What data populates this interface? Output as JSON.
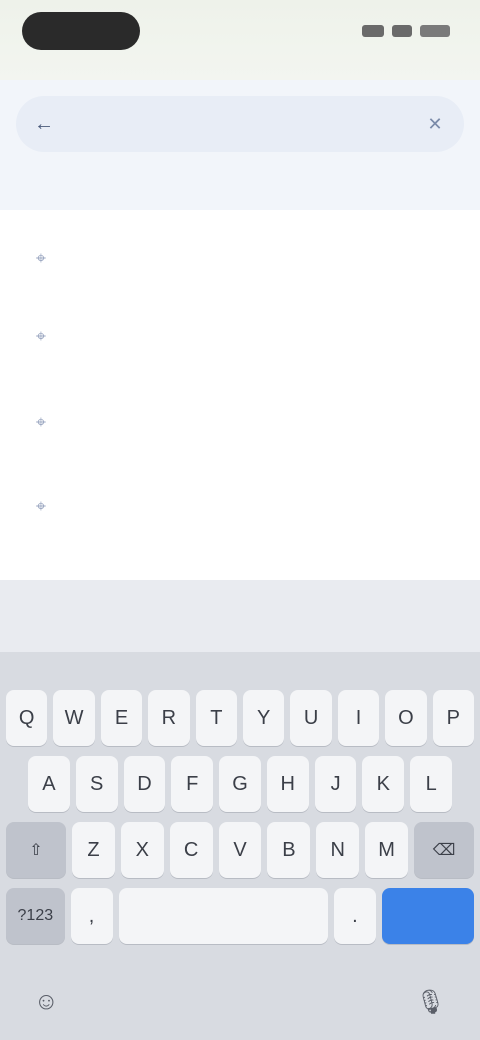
{
  "status_bar": {
    "time": "",
    "icons": [
      "signal-icon",
      "wifi-icon",
      "battery-icon"
    ]
  },
  "search": {
    "value": "",
    "placeholder": "",
    "back_icon": "arrow-left-icon",
    "clear_icon": "close-icon"
  },
  "section": {
    "label": ""
  },
  "results": [
    {
      "title": "",
      "bold": "",
      "sub": ""
    },
    {
      "title": "",
      "bold": "",
      "sub": ""
    },
    {
      "title": "",
      "bold": "",
      "sub": ""
    },
    {
      "title": "",
      "bold": "",
      "sub": ""
    }
  ],
  "suggestions": [
    "",
    "",
    ""
  ],
  "keyboard": {
    "row1": [
      "Q",
      "W",
      "E",
      "R",
      "T",
      "Y",
      "U",
      "I",
      "O",
      "P"
    ],
    "row2": [
      "A",
      "S",
      "D",
      "F",
      "G",
      "H",
      "J",
      "K",
      "L"
    ],
    "row3": [
      "Z",
      "X",
      "C",
      "V",
      "B",
      "N",
      "M"
    ],
    "shift_label": "⇧",
    "backspace_label": "⌫",
    "numbers_label": "?123",
    "comma_label": ",",
    "space_label": "",
    "period_label": ".",
    "go_label": "",
    "emoji_icon": "emoji-icon",
    "mic_icon": "microphone-icon"
  },
  "colors": {
    "accent": "#3b82e8",
    "search_bg": "#e8edf6",
    "keyboard_bg": "#d8dbe1"
  }
}
